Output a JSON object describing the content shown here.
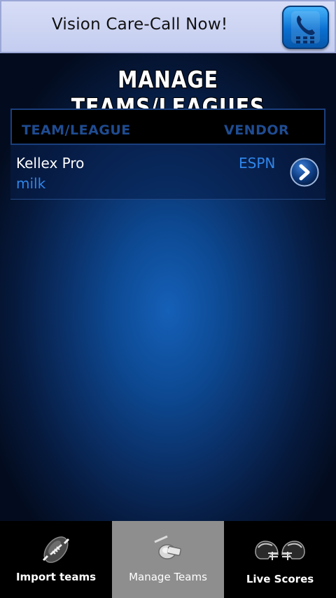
{
  "ad": {
    "text": "Vision Care-Call Now!",
    "icon": "phone-icon"
  },
  "page": {
    "title": "MANAGE TEAMS/LEAGUES"
  },
  "table": {
    "headers": {
      "team_league": "TEAM/LEAGUE",
      "vendor": "VENDOR"
    },
    "rows": [
      {
        "team": "Kellex Pro",
        "league": "milk",
        "vendor": "ESPN",
        "action_icon": "chevron-right-icon"
      }
    ]
  },
  "tabs": [
    {
      "label": "Import teams",
      "icon": "football-icon",
      "selected": false
    },
    {
      "label": "Manage Teams",
      "icon": "whistle-icon",
      "selected": true
    },
    {
      "label": "Live Scores",
      "icon": "helmets-icon",
      "selected": false
    }
  ],
  "colors": {
    "header_text": "#1f4c92",
    "accent_blue": "#2f86ea",
    "selected_tab": "#8e8e8e"
  }
}
